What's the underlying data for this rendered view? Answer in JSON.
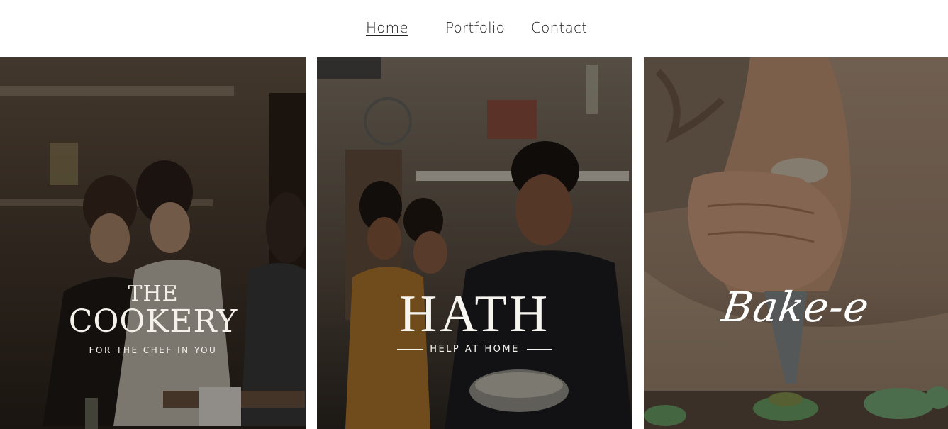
{
  "nav": {
    "items": [
      {
        "label": "Home",
        "active": true
      },
      {
        "label": "Portfolio",
        "active": false
      },
      {
        "label": "Contact",
        "active": false
      }
    ]
  },
  "panels": {
    "cookery": {
      "logo_line1": "THE",
      "logo_line2": "COOKERY",
      "tagline": "FOR THE CHEF IN YOU"
    },
    "hath": {
      "logo": "HATH",
      "tagline": "HELP AT HOME"
    },
    "bakere": {
      "logo": "Bake-e"
    }
  },
  "colors": {
    "nav_bg": "#ffffff",
    "nav_text": "#222222",
    "overlay_text": "#f4f1ea",
    "cookery_photo": "#3a2e24",
    "hath_photo": "#4a3f36",
    "bakere_photo": "#8a6a52",
    "macaron_green": "#6fa56a"
  }
}
